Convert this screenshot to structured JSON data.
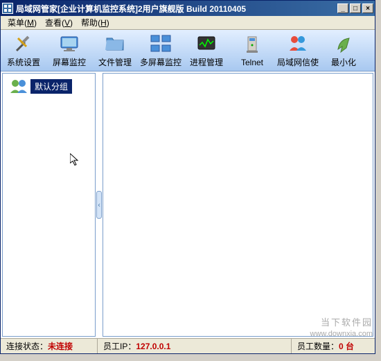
{
  "window": {
    "title": "局域网管家[企业计算机监控系统]2用户旗舰版  Build 20110405"
  },
  "menubar": {
    "items": [
      {
        "label": "菜单",
        "key": "M"
      },
      {
        "label": "查看",
        "key": "V"
      },
      {
        "label": "帮助",
        "key": "H"
      }
    ]
  },
  "toolbar": {
    "buttons": [
      {
        "label": "系统设置",
        "icon": "settings"
      },
      {
        "label": "屏幕监控",
        "icon": "monitor"
      },
      {
        "label": "文件管理",
        "icon": "folder"
      },
      {
        "label": "多屏幕监控",
        "icon": "multi-monitor"
      },
      {
        "label": "进程管理",
        "icon": "process"
      },
      {
        "label": "Telnet",
        "icon": "telnet"
      },
      {
        "label": "局域网信使",
        "icon": "messenger"
      },
      {
        "label": "最小化",
        "icon": "minimize"
      }
    ]
  },
  "tree": {
    "root_label": "默认分组"
  },
  "statusbar": {
    "conn_label": "连接状态：",
    "conn_value": "未连接",
    "ip_label": "员工IP：",
    "ip_value": "127.0.0.1",
    "count_label": "员工数量：",
    "count_value": "0 台"
  },
  "watermark": {
    "title": "当下软件园",
    "url": "www.downxia.com"
  }
}
